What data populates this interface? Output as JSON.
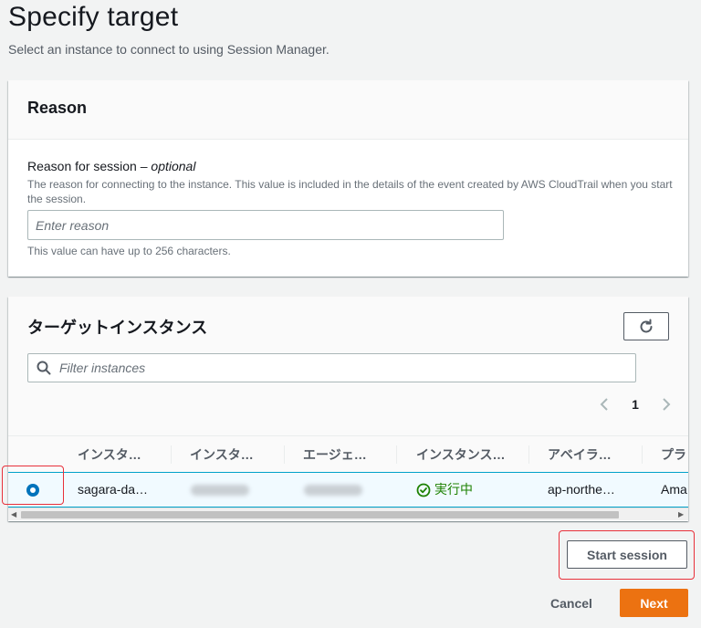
{
  "page": {
    "title": "Specify target",
    "description": "Select an instance to connect to using Session Manager."
  },
  "reason": {
    "header": "Reason",
    "label": "Reason for session – ",
    "label_optional": "optional",
    "description": "The reason for connecting to the instance. This value is included in the details of the event created by AWS CloudTrail when you start the session.",
    "placeholder": "Enter reason",
    "constraint": "This value can have up to 256 characters."
  },
  "target": {
    "header": "ターゲットインスタンス",
    "filter_placeholder": "Filter instances",
    "page_number": "1",
    "columns": [
      "インスタ…",
      "インスタ…",
      "エージェ…",
      "インスタンス…",
      "アベイラ…",
      "プラ"
    ],
    "row": {
      "name": "sagara-da…",
      "status": "実行中",
      "availability_zone": "ap-northe…",
      "platform": "Ama"
    }
  },
  "actions": {
    "start_session": "Start session",
    "cancel": "Cancel",
    "next": "Next"
  },
  "colors": {
    "primary": "#ec7211",
    "selected_radio": "#0073bb",
    "status_running": "#1d8102",
    "highlight": "#e8303a"
  },
  "icons": {
    "refresh": "refresh-icon",
    "search": "search-icon",
    "status": "check-circle-icon"
  }
}
